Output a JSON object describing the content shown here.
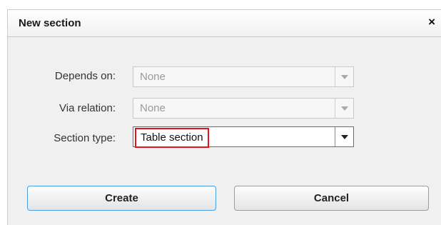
{
  "dialog": {
    "title": "New section",
    "close_icon": "close-icon",
    "close_glyph": "×"
  },
  "form": {
    "depends_on": {
      "label": "Depends on:",
      "value": "None",
      "disabled": true
    },
    "via_relation": {
      "label": "Via relation:",
      "value": "None",
      "disabled": true
    },
    "section_type": {
      "label": "Section type:",
      "value": "Table section",
      "disabled": false
    }
  },
  "buttons": {
    "create": "Create",
    "cancel": "Cancel"
  },
  "colors": {
    "highlight_border": "#e3141c",
    "primary_button_border": "#4c9ce0"
  }
}
